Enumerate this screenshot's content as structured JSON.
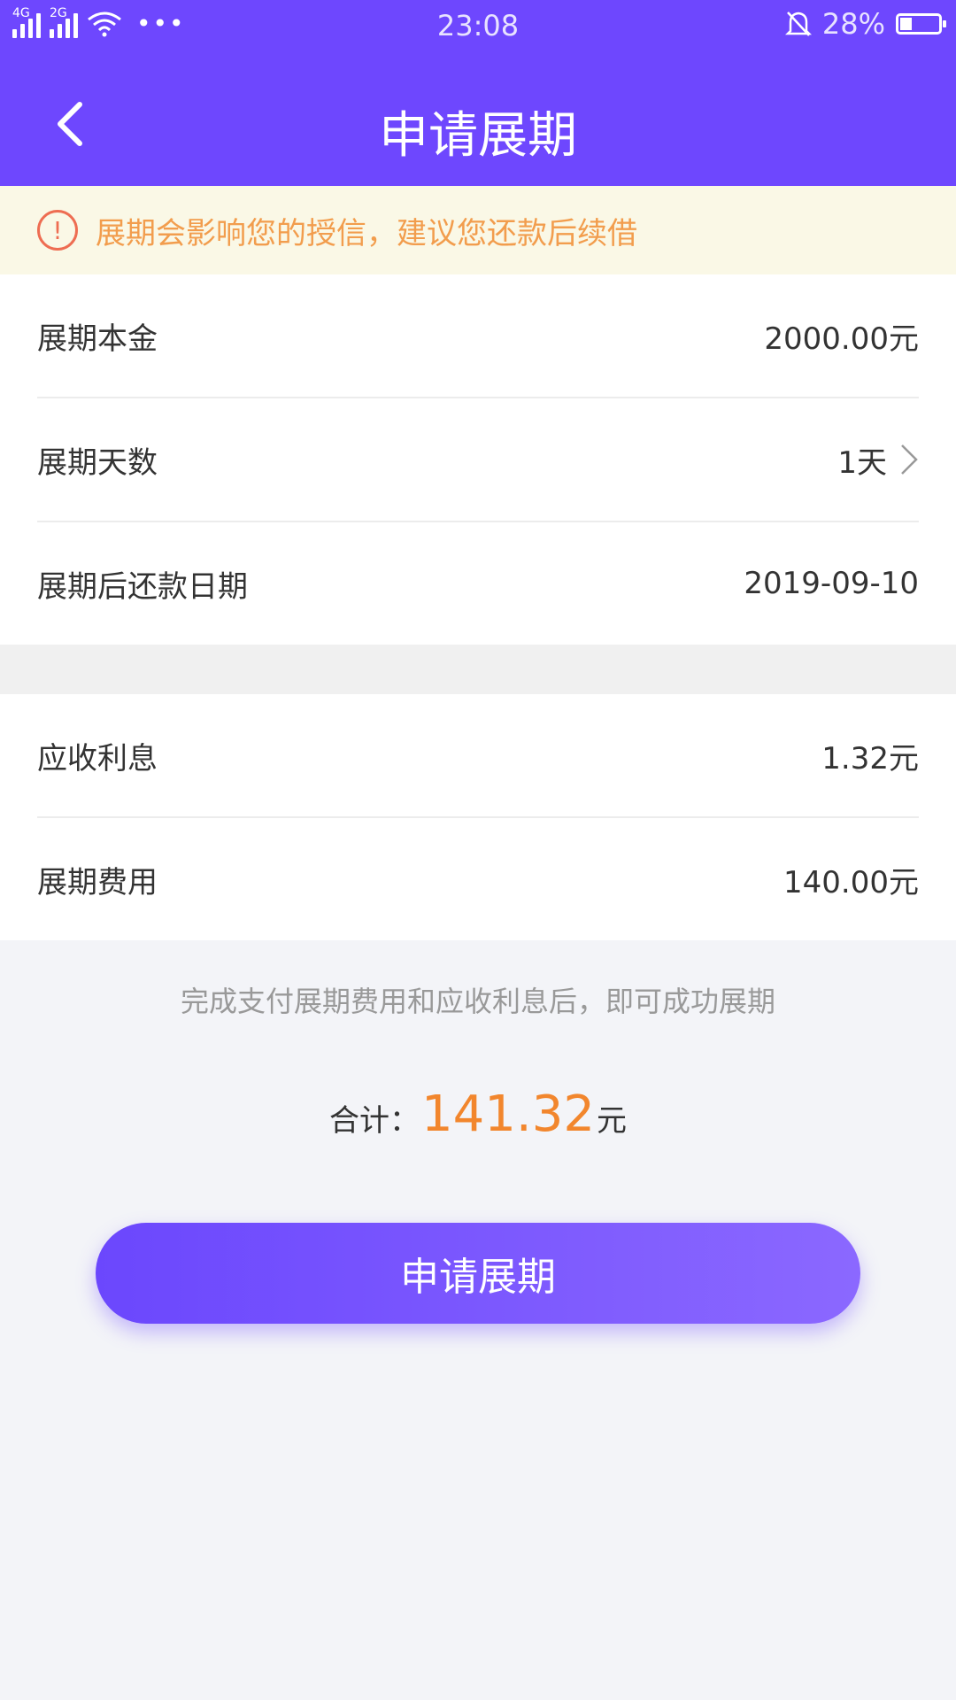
{
  "status_bar": {
    "signal1_label": "4G",
    "signal2_label": "2G",
    "dots": "•••",
    "time": "23:08",
    "battery": "28%"
  },
  "header": {
    "title": "申请展期",
    "back_icon": "chevron-left-icon"
  },
  "notice": {
    "icon": "exclamation-circle-icon",
    "text": "展期会影响您的授信，建议您还款后续借"
  },
  "section1": {
    "rows": [
      {
        "label": "展期本金",
        "value": "2000.00元"
      },
      {
        "label": "展期天数",
        "value": "1天"
      },
      {
        "label": "展期后还款日期",
        "value": "2019-09-10"
      }
    ]
  },
  "section2": {
    "rows": [
      {
        "label": "应收利息",
        "value": "1.32元"
      },
      {
        "label": "展期费用",
        "value": "140.00元"
      }
    ]
  },
  "hint": "完成支付展期费用和应收利息后，即可成功展期",
  "total": {
    "label": "合计：",
    "amount": "141.32",
    "unit": "元"
  },
  "submit_label": "申请展期",
  "colors": {
    "primary": "#6e47fe",
    "accent": "#f2862d",
    "notice_bg": "#faf8e6",
    "warning": "#ee6d52"
  }
}
